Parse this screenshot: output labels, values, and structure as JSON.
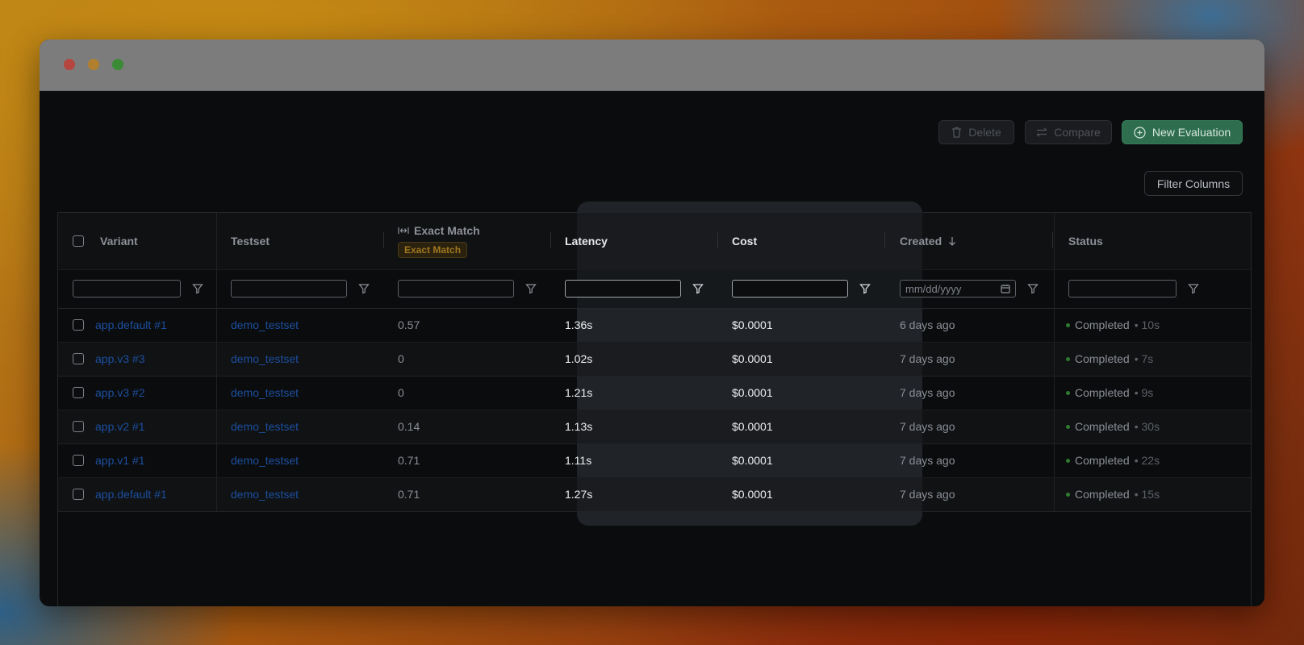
{
  "toolbar": {
    "delete_label": "Delete",
    "compare_label": "Compare",
    "new_evaluation_label": "New Evaluation",
    "filter_columns_label": "Filter Columns"
  },
  "table": {
    "headers": {
      "variant": "Variant",
      "testset": "Testset",
      "exact_match": "Exact Match",
      "exact_match_badge": "Exact Match",
      "latency": "Latency",
      "cost": "Cost",
      "created": "Created",
      "status": "Status"
    },
    "date_placeholder": "mm/dd/yyyy",
    "rows": [
      {
        "variant": "app.default #1",
        "testset": "demo_testset",
        "exact_match": "0.57",
        "latency": "1.36s",
        "cost": "$0.0001",
        "created": "6 days ago",
        "status": "Completed",
        "duration": "• 10s"
      },
      {
        "variant": "app.v3 #3",
        "testset": "demo_testset",
        "exact_match": "0",
        "latency": "1.02s",
        "cost": "$0.0001",
        "created": "7 days ago",
        "status": "Completed",
        "duration": "• 7s"
      },
      {
        "variant": "app.v3 #2",
        "testset": "demo_testset",
        "exact_match": "0",
        "latency": "1.21s",
        "cost": "$0.0001",
        "created": "7 days ago",
        "status": "Completed",
        "duration": "• 9s"
      },
      {
        "variant": "app.v2 #1",
        "testset": "demo_testset",
        "exact_match": "0.14",
        "latency": "1.13s",
        "cost": "$0.0001",
        "created": "7 days ago",
        "status": "Completed",
        "duration": "• 30s"
      },
      {
        "variant": "app.v1 #1",
        "testset": "demo_testset",
        "exact_match": "0.71",
        "latency": "1.11s",
        "cost": "$0.0001",
        "created": "7 days ago",
        "status": "Completed",
        "duration": "• 22s"
      },
      {
        "variant": "app.default #1",
        "testset": "demo_testset",
        "exact_match": "0.71",
        "latency": "1.27s",
        "cost": "$0.0001",
        "created": "7 days ago",
        "status": "Completed",
        "duration": "• 15s"
      }
    ]
  },
  "colors": {
    "primary_button": "#2e6e4e",
    "link": "#1c4f9e",
    "status_completed": "#2f7a2f",
    "badge_text": "#a07620"
  }
}
